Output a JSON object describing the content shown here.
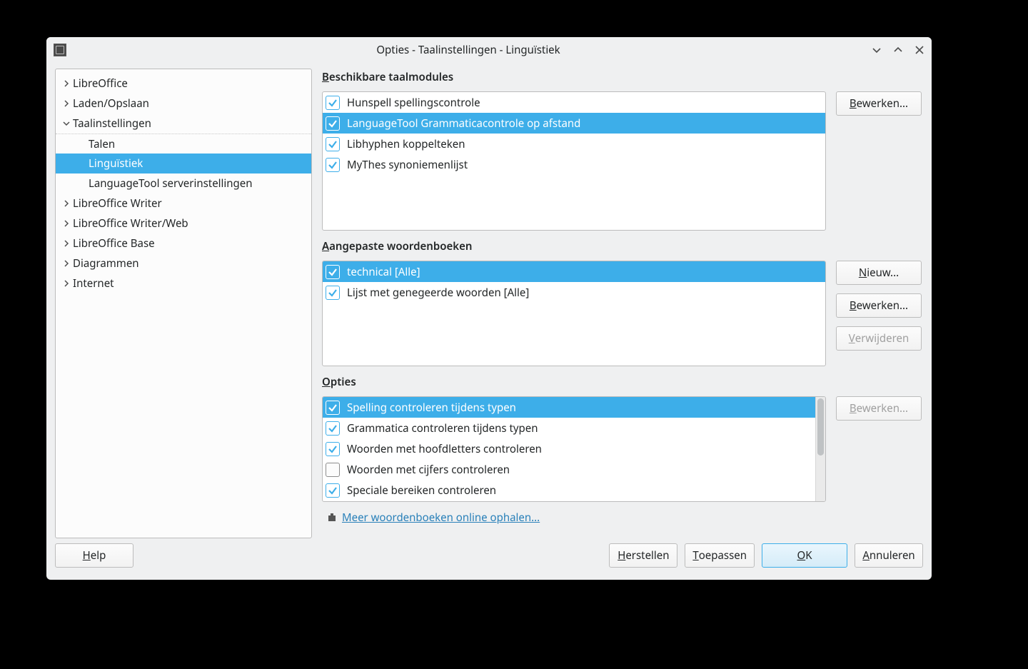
{
  "titlebar": {
    "title": "Opties - Taalinstellingen - Linguïstiek"
  },
  "sidebar": {
    "items": [
      {
        "label": "LibreOffice",
        "chevron": ">",
        "level": 0
      },
      {
        "label": "Laden/Opslaan",
        "chevron": ">",
        "level": 0
      },
      {
        "label": "Taalinstellingen",
        "chevron": "v",
        "level": 0
      },
      {
        "label": "Talen",
        "level": 1
      },
      {
        "label": "Linguïstiek",
        "level": 1,
        "selected": true
      },
      {
        "label": "LanguageTool serverinstellingen",
        "level": 1
      },
      {
        "label": "LibreOffice Writer",
        "chevron": ">",
        "level": 0
      },
      {
        "label": "LibreOffice Writer/Web",
        "chevron": ">",
        "level": 0
      },
      {
        "label": "LibreOffice Base",
        "chevron": ">",
        "level": 0
      },
      {
        "label": "Diagrammen",
        "chevron": ">",
        "level": 0
      },
      {
        "label": "Internet",
        "chevron": ">",
        "level": 0
      }
    ]
  },
  "sections": {
    "modules": {
      "title_pre": "B",
      "title_rest": "eschikbare taalmodules",
      "items": [
        {
          "label": "Hunspell spellingscontrole",
          "checked": true
        },
        {
          "label": "LanguageTool Grammaticacontrole op afstand",
          "checked": true,
          "selected": true
        },
        {
          "label": "Libhyphen koppelteken",
          "checked": true
        },
        {
          "label": "MyThes synoniemenlijst",
          "checked": true
        }
      ],
      "edit_label_pre": "B",
      "edit_label_rest": "ewerken..."
    },
    "dicts": {
      "title_pre": "A",
      "title_rest": "angepaste woordenboeken",
      "items": [
        {
          "label": "technical [Alle]",
          "checked": true,
          "selected": true
        },
        {
          "label": "Lijst met genegeerde woorden [Alle]",
          "checked": true
        }
      ],
      "new_pre": "N",
      "new_rest": "ieuw...",
      "edit_pre": "B",
      "edit_rest": "ewerken...",
      "del_pre": "V",
      "del_rest": "erwijderen"
    },
    "options": {
      "title_pre": "O",
      "title_rest": "pties",
      "items": [
        {
          "label": "Spelling controleren tijdens typen",
          "checked": true,
          "selected": true
        },
        {
          "label": "Grammatica controleren tijdens typen",
          "checked": true
        },
        {
          "label": "Woorden met hoofdletters controleren",
          "checked": true
        },
        {
          "label": "Woorden met cijfers controleren",
          "checked": false
        },
        {
          "label": "Speciale bereiken controleren",
          "checked": true
        }
      ],
      "edit_pre": "B",
      "edit_rest": "ewerken..."
    },
    "link_text": "Meer woordenboeken online ophalen..."
  },
  "footer": {
    "help_pre": "H",
    "help_rest": "elp",
    "reset_pre": "H",
    "reset_rest": "erstellen",
    "apply_pre": "T",
    "apply_rest": "oepassen",
    "ok_pre": "O",
    "ok_rest": "K",
    "cancel_pre": "A",
    "cancel_rest": "nnuleren"
  }
}
